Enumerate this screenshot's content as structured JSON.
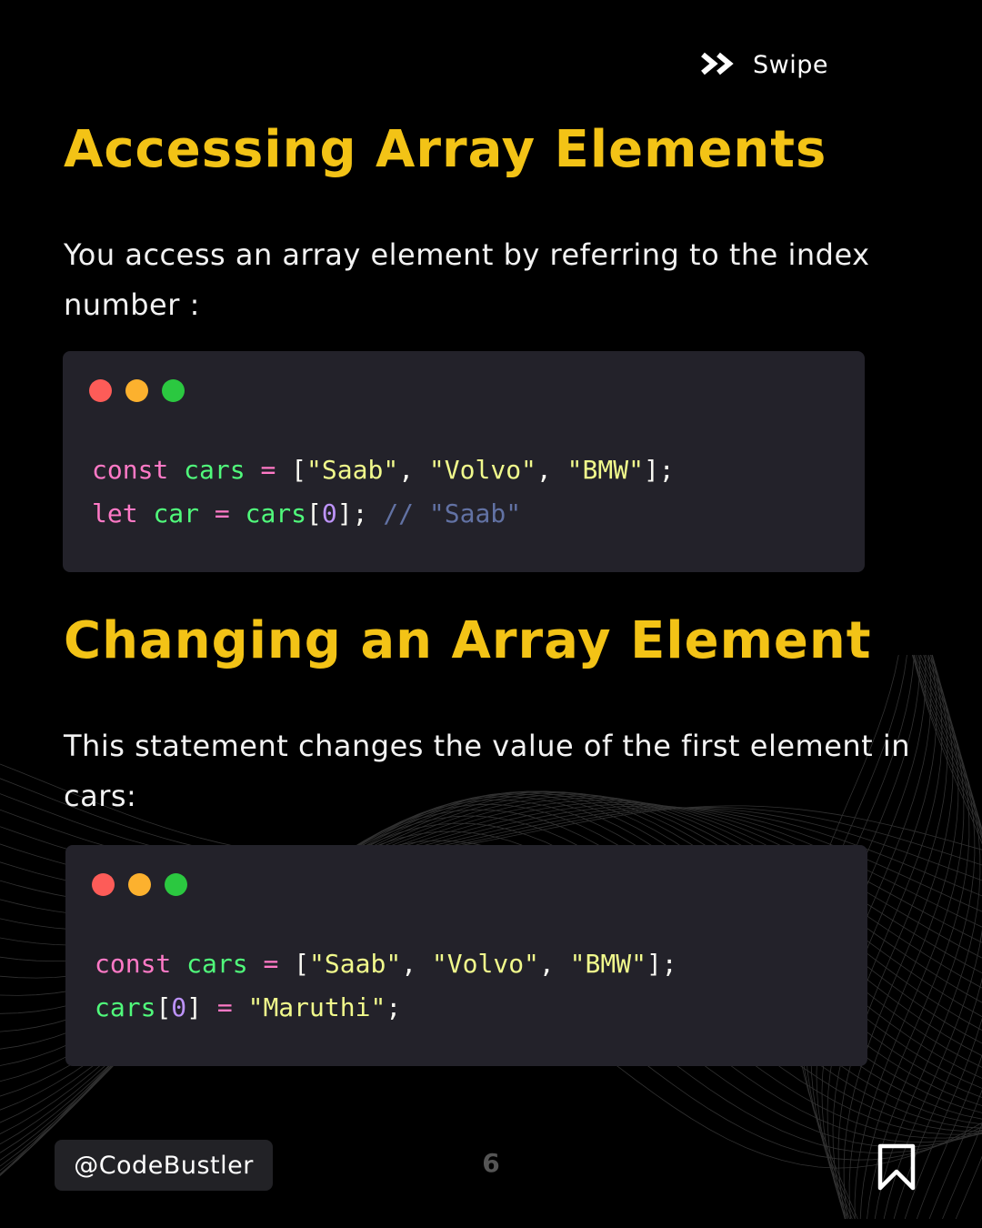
{
  "swipe": {
    "label": "Swipe",
    "icon": "double-chevron-right-icon"
  },
  "section1": {
    "heading": "Accessing Array Elements",
    "description": "You access an array element by referring to the index number :",
    "code_lines": [
      [
        {
          "t": "const",
          "c": "kw"
        },
        {
          "t": " ",
          "c": ""
        },
        {
          "t": "cars",
          "c": "var"
        },
        {
          "t": " ",
          "c": ""
        },
        {
          "t": "=",
          "c": "op"
        },
        {
          "t": " [",
          "c": ""
        },
        {
          "t": "\"Saab\"",
          "c": "str"
        },
        {
          "t": ", ",
          "c": ""
        },
        {
          "t": "\"Volvo\"",
          "c": "str"
        },
        {
          "t": ", ",
          "c": ""
        },
        {
          "t": "\"BMW\"",
          "c": "str"
        },
        {
          "t": "];",
          "c": ""
        }
      ],
      [
        {
          "t": "let",
          "c": "kw"
        },
        {
          "t": " ",
          "c": ""
        },
        {
          "t": "car",
          "c": "var"
        },
        {
          "t": " ",
          "c": ""
        },
        {
          "t": "=",
          "c": "op"
        },
        {
          "t": " ",
          "c": ""
        },
        {
          "t": "cars",
          "c": "var"
        },
        {
          "t": "[",
          "c": ""
        },
        {
          "t": "0",
          "c": "num"
        },
        {
          "t": "]; ",
          "c": ""
        },
        {
          "t": "// \"Saab\"",
          "c": "cm"
        }
      ]
    ]
  },
  "section2": {
    "heading": "Changing an Array Element",
    "description": "This statement changes the value of the first element in cars:",
    "code_lines": [
      [
        {
          "t": "const",
          "c": "kw"
        },
        {
          "t": " ",
          "c": ""
        },
        {
          "t": "cars",
          "c": "var"
        },
        {
          "t": " ",
          "c": ""
        },
        {
          "t": "=",
          "c": "op"
        },
        {
          "t": " [",
          "c": ""
        },
        {
          "t": "\"Saab\"",
          "c": "str"
        },
        {
          "t": ", ",
          "c": ""
        },
        {
          "t": "\"Volvo\"",
          "c": "str"
        },
        {
          "t": ", ",
          "c": ""
        },
        {
          "t": "\"BMW\"",
          "c": "str"
        },
        {
          "t": "];",
          "c": ""
        }
      ],
      [
        {
          "t": "cars",
          "c": "var"
        },
        {
          "t": "[",
          "c": ""
        },
        {
          "t": "0",
          "c": "num"
        },
        {
          "t": "] ",
          "c": ""
        },
        {
          "t": "=",
          "c": "op"
        },
        {
          "t": " ",
          "c": ""
        },
        {
          "t": "\"Maruthi\"",
          "c": "str"
        },
        {
          "t": ";",
          "c": ""
        }
      ]
    ]
  },
  "footer": {
    "handle": "@CodeBustler",
    "page_number": "6",
    "bookmark_icon": "bookmark-icon"
  },
  "colors": {
    "background": "#000000",
    "heading": "#f3c316",
    "code_bg": "#23222a",
    "keyword": "#ff79c6",
    "variable": "#50fa7b",
    "string": "#f1fa8c",
    "number": "#bd93f9",
    "comment": "#6272a4"
  }
}
